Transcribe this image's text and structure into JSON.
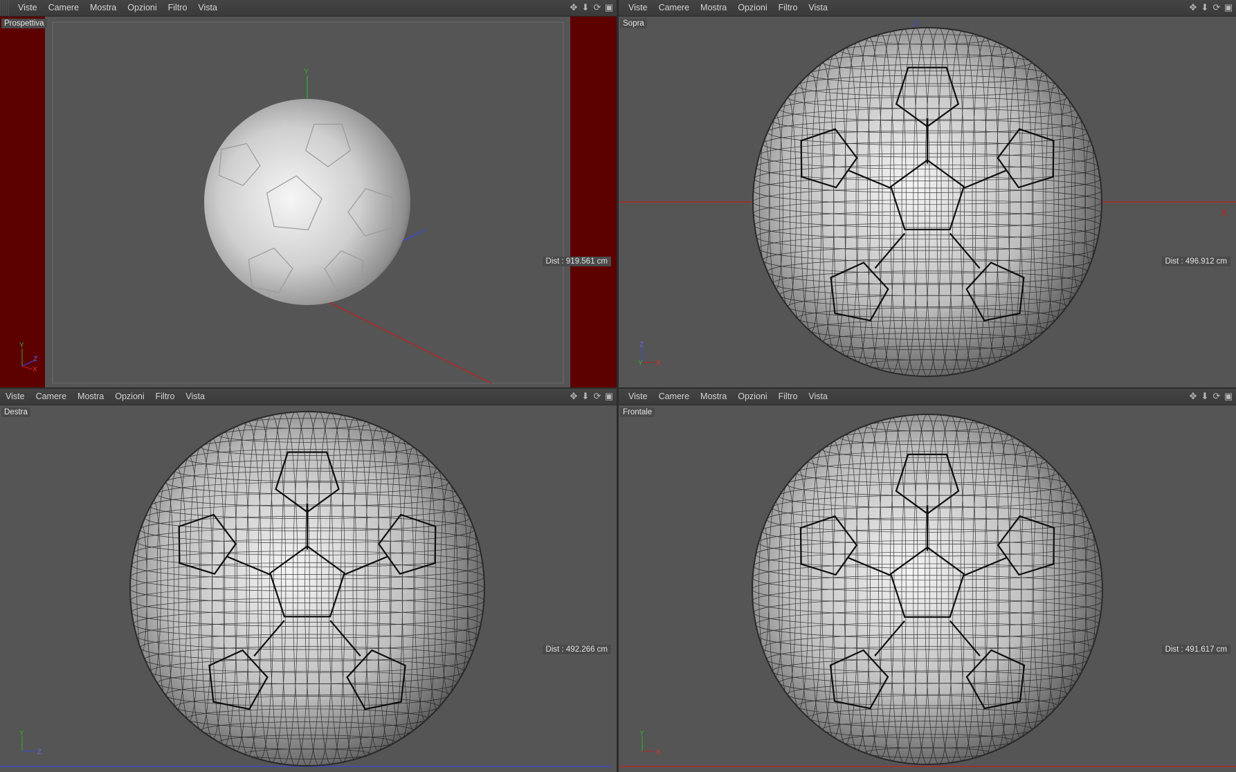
{
  "menu": [
    "Viste",
    "Camere",
    "Mostra",
    "Opzioni",
    "Filtro",
    "Vista"
  ],
  "tool_icons": [
    "move-icon",
    "down-arrow-icon",
    "rotate-icon",
    "maximize-icon"
  ],
  "colors": {
    "viewport_bg": "#555555",
    "safe_frame": "#5c0000",
    "axis_x": "#c02020",
    "axis_y": "#2fb12f",
    "axis_z": "#3a49d4"
  },
  "viewports": {
    "perspective": {
      "label": "Prospettiva",
      "dist": "Dist : 919.561 cm"
    },
    "top": {
      "label": "Sopra",
      "dist": "Dist : 496.912 cm"
    },
    "right": {
      "label": "Destra",
      "dist": "Dist : 492.266 cm"
    },
    "front": {
      "label": "Frontale",
      "dist": "Dist : 491.617 cm"
    }
  },
  "axis_labels": {
    "x": "X",
    "y": "Y",
    "z": "Z"
  }
}
